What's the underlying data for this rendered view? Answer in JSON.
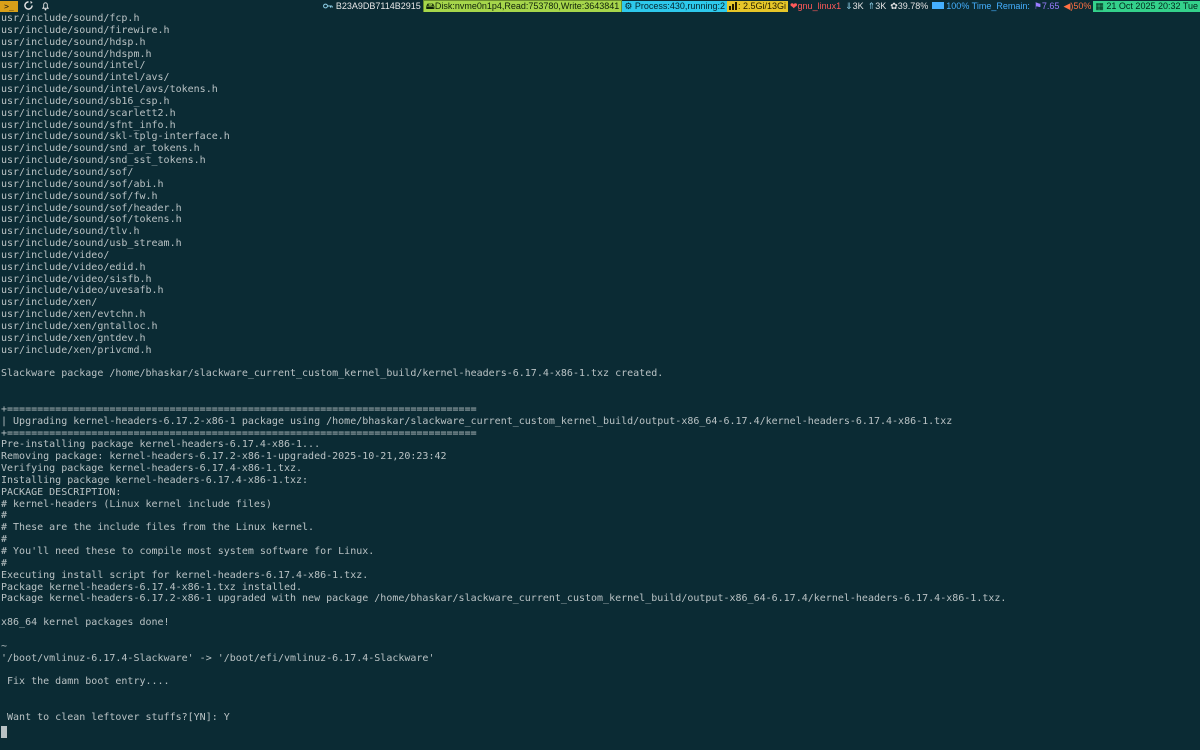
{
  "statusbar": {
    "terminal_button": ">_",
    "refresh_icon": "refresh-icon",
    "bell_icon": "bell-icon",
    "host_icon": "key-icon",
    "host": "B23A9DB7114B2915",
    "disk": "Disk:nvme0n1p4,Read:753780,Write:3643841",
    "process": "Process:430,running:2",
    "memory": ": 2.5Gi/13Gi",
    "net_label": "gnu_linux1",
    "down": "3K",
    "up": "3K",
    "cpu": "39.78%",
    "battery": "100% Time_Remain:",
    "load": "7.65",
    "volume": "50%",
    "datetime": "21 Oct 2025 20:32 Tue",
    "colors": {
      "background": "#0b2b34",
      "disk": "#a6d64b",
      "process": "#2ec9ec",
      "memory": "#e6c629",
      "net": "#ff5a5a",
      "battery": "#45b0ff",
      "date": "#34d18b",
      "terminal_button": "#d8a019"
    }
  },
  "terminal": {
    "lines": [
      "usr/include/sound/fcp.h",
      "usr/include/sound/firewire.h",
      "usr/include/sound/hdsp.h",
      "usr/include/sound/hdspm.h",
      "usr/include/sound/intel/",
      "usr/include/sound/intel/avs/",
      "usr/include/sound/intel/avs/tokens.h",
      "usr/include/sound/sb16_csp.h",
      "usr/include/sound/scarlett2.h",
      "usr/include/sound/sfnt_info.h",
      "usr/include/sound/skl-tplg-interface.h",
      "usr/include/sound/snd_ar_tokens.h",
      "usr/include/sound/snd_sst_tokens.h",
      "usr/include/sound/sof/",
      "usr/include/sound/sof/abi.h",
      "usr/include/sound/sof/fw.h",
      "usr/include/sound/sof/header.h",
      "usr/include/sound/sof/tokens.h",
      "usr/include/sound/tlv.h",
      "usr/include/sound/usb_stream.h",
      "usr/include/video/",
      "usr/include/video/edid.h",
      "usr/include/video/sisfb.h",
      "usr/include/video/uvesafb.h",
      "usr/include/xen/",
      "usr/include/xen/evtchn.h",
      "usr/include/xen/gntalloc.h",
      "usr/include/xen/gntdev.h",
      "usr/include/xen/privcmd.h",
      "",
      "Slackware package /home/bhaskar/slackware_current_custom_kernel_build/kernel-headers-6.17.4-x86-1.txz created.",
      "",
      "",
      "+==============================================================================",
      "| Upgrading kernel-headers-6.17.2-x86-1 package using /home/bhaskar/slackware_current_custom_kernel_build/output-x86_64-6.17.4/kernel-headers-6.17.4-x86-1.txz",
      "+==============================================================================",
      "Pre-installing package kernel-headers-6.17.4-x86-1...",
      "Removing package: kernel-headers-6.17.2-x86-1-upgraded-2025-10-21,20:23:42",
      "Verifying package kernel-headers-6.17.4-x86-1.txz.",
      "Installing package kernel-headers-6.17.4-x86-1.txz:",
      "PACKAGE DESCRIPTION:",
      "# kernel-headers (Linux kernel include files)",
      "#",
      "# These are the include files from the Linux kernel.",
      "#",
      "# You'll need these to compile most system software for Linux.",
      "#",
      "Executing install script for kernel-headers-6.17.4-x86-1.txz.",
      "Package kernel-headers-6.17.4-x86-1.txz installed.",
      "Package kernel-headers-6.17.2-x86-1 upgraded with new package /home/bhaskar/slackware_current_custom_kernel_build/output-x86_64-6.17.4/kernel-headers-6.17.4-x86-1.txz.",
      "",
      "x86_64 kernel packages done!",
      "",
      "~",
      "'/boot/vmlinuz-6.17.4-Slackware' -> '/boot/efi/vmlinuz-6.17.4-Slackware'",
      "",
      " Fix the damn boot entry....",
      "",
      "",
      " Want to clean leftover stuffs?[YN]: Y"
    ]
  }
}
